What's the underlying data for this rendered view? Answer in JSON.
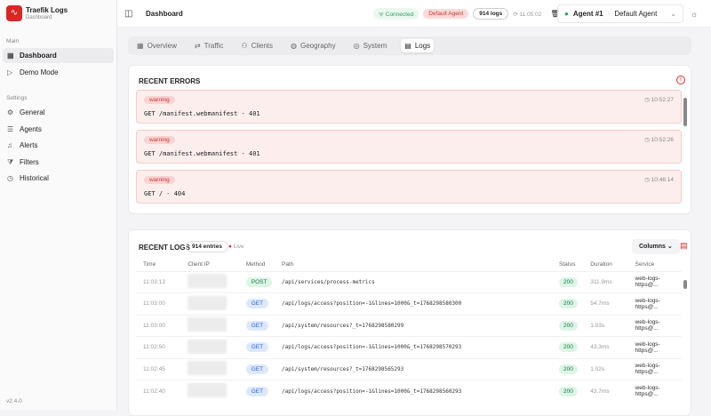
{
  "app": {
    "title": "Traefik Logs",
    "subtitle": "Dashboard",
    "version": "v2.4.0"
  },
  "sidebar": {
    "main_label": "Main",
    "settings_label": "Settings",
    "main_items": [
      {
        "label": "Dashboard",
        "icon": "grid-icon"
      },
      {
        "label": "Demo Mode",
        "icon": "play-icon"
      }
    ],
    "settings_items": [
      {
        "label": "General",
        "icon": "gear-icon"
      },
      {
        "label": "Agents",
        "icon": "server-icon"
      },
      {
        "label": "Alerts",
        "icon": "bell-icon"
      },
      {
        "label": "Filters",
        "icon": "filter-icon"
      },
      {
        "label": "Historical",
        "icon": "history-icon"
      }
    ]
  },
  "header": {
    "title": "Dashboard",
    "connected": "Connected",
    "agent_badge": "Default Agent",
    "logs_count": "914 logs",
    "refresh_time": "11:05:02",
    "agent_select": {
      "name": "Agent #1",
      "value": "Default Agent"
    }
  },
  "tabs": [
    {
      "label": "Overview"
    },
    {
      "label": "Traffic"
    },
    {
      "label": "Clients"
    },
    {
      "label": "Geography"
    },
    {
      "label": "System"
    },
    {
      "label": "Logs"
    }
  ],
  "errors": {
    "title": "RECENT ERRORS",
    "items": [
      {
        "level": "warning",
        "text": "GET /manifest.webmanifest - 401",
        "time": "10:52:27"
      },
      {
        "level": "warning",
        "text": "GET /manifest.webmanifest - 401",
        "time": "10:52:26"
      },
      {
        "level": "warning",
        "text": "GET / - 404",
        "time": "10:46:14"
      }
    ]
  },
  "logs": {
    "title": "RECENT LOGS",
    "entries": "914 entries",
    "live": "Live",
    "columns_button": "Columns",
    "headers": [
      "Time",
      "Client IP",
      "Method",
      "Path",
      "Status",
      "Duration",
      "Service"
    ],
    "rows": [
      {
        "time": "11:03:13",
        "method": "POST",
        "path": "/api/services/process-metrics",
        "status": "200",
        "duration": "311.9ms",
        "service": "web-logs-https@..."
      },
      {
        "time": "11:03:00",
        "method": "GET",
        "path": "/api/logs/access?position=-1&lines=1000&_t=1768298580300",
        "status": "200",
        "duration": "54.7ms",
        "service": "web-logs-https@..."
      },
      {
        "time": "11:03:00",
        "method": "GET",
        "path": "/api/system/resources?_t=1768298580299",
        "status": "200",
        "duration": "1.03s",
        "service": "web-logs-https@..."
      },
      {
        "time": "11:02:50",
        "method": "GET",
        "path": "/api/logs/access?position=-1&lines=1000&_t=1768298570293",
        "status": "200",
        "duration": "43.3ms",
        "service": "web-logs-https@..."
      },
      {
        "time": "11:02:45",
        "method": "GET",
        "path": "/api/system/resources?_t=1768298565293",
        "status": "200",
        "duration": "1.02s",
        "service": "web-logs-https@..."
      },
      {
        "time": "11:02:40",
        "method": "GET",
        "path": "/api/logs/access?position=-1&lines=1000&_t=1768298560293",
        "status": "200",
        "duration": "43.7ms",
        "service": "web-logs-https@..."
      }
    ]
  }
}
